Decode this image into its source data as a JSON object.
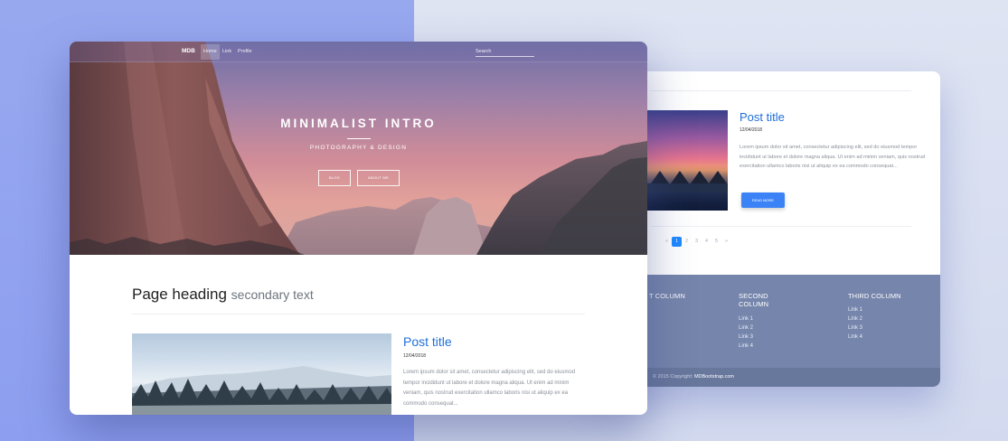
{
  "navbar": {
    "brand": "MDB",
    "items": [
      {
        "label": "Home",
        "active": true
      },
      {
        "label": "Link",
        "active": false
      },
      {
        "label": "Profile",
        "active": false
      }
    ],
    "search_placeholder": "Search"
  },
  "hero": {
    "title": "MINIMALIST INTRO",
    "subtitle": "PHOTOGRAPHY & DESIGN",
    "buttons": [
      {
        "label": "BLOG"
      },
      {
        "label": "ABOUT ME"
      }
    ]
  },
  "page": {
    "heading": "Page heading",
    "secondary": "secondary text"
  },
  "post": {
    "title": "Post title",
    "date": "12/04/2018",
    "text": "Lorem ipsum dolor sit amet, consectetur adipiscing elit, sed do eiusmod tempor incididunt ut labore et dolore magna aliqua. Ut enim ad minim veniam, quis nostrud exercitation ullamco laboris nisi ut aliquip ex ea commodo consequat..."
  },
  "back_post": {
    "title": "Post title",
    "date": "12/04/2018",
    "text": "Lorem ipsum dolor sit amet, consectetur adipiscing elit, sed do eiusmod tempor incididunt ut labore et dolore magna aliqua. Ut enim ad minim veniam, quis nostrud exercitation ullamco laboris nisi ut aliquip ex ea commodo consequat...",
    "button": "READ MORE"
  },
  "pagination": {
    "prev": "«",
    "pages": [
      "1",
      "2",
      "3",
      "4",
      "5"
    ],
    "active_page": "1",
    "next": "»"
  },
  "footer": {
    "columns": [
      {
        "heading": "T COLUMN",
        "links": []
      },
      {
        "heading": "SECOND COLUMN",
        "links": [
          "Link 1",
          "Link 2",
          "Link 3",
          "Link 4"
        ]
      },
      {
        "heading": "THIRD COLUMN",
        "links": [
          "Link 1",
          "Link 2",
          "Link 3",
          "Link 4"
        ]
      }
    ],
    "copyright_prefix": "© 2015 Copyright:",
    "copyright_link": "MDBootstrap.com"
  },
  "colors": {
    "accent": "#1e6fd9",
    "button": "#3b82f6",
    "footer": "#7585ab",
    "footer_bottom": "#68779c",
    "bg_left": "#98a8ef",
    "bg_right": "#dfe4f3"
  }
}
